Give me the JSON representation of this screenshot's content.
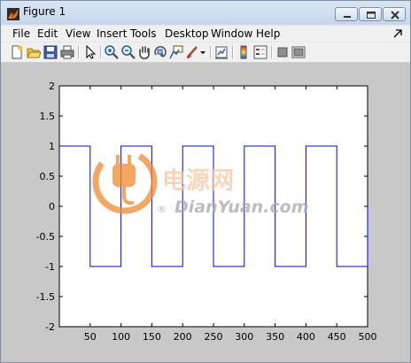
{
  "window": {
    "title": "Figure 1",
    "icons": {
      "app": "matlab-figure-icon",
      "minimize": "minimize-icon",
      "maximize": "maximize-icon",
      "close": "close-icon"
    }
  },
  "menubar": {
    "items": [
      "File",
      "Edit",
      "View",
      "Insert",
      "Tools",
      "Desktop",
      "Window",
      "Help"
    ],
    "dock_icon": "dock-arrow-icon"
  },
  "toolbar": {
    "icons": [
      "new-figure-icon",
      "open-file-icon",
      "save-icon",
      "print-icon",
      "pointer-icon",
      "zoom-in-icon",
      "zoom-out-icon",
      "pan-hand-icon",
      "rotate-3d-icon",
      "data-cursor-icon",
      "brush-icon",
      "dropdown-arrow-icon",
      "link-plot-icon",
      "colorbar-icon",
      "legend-icon",
      "hide-plot-tools-icon",
      "show-plot-tools-icon"
    ]
  },
  "watermark": {
    "chinese_text": "电源网",
    "site_text": "DianYuan.com",
    "registered_mark": "®",
    "logo_icon": "power-plug-logo-icon"
  },
  "chart_data": {
    "type": "line",
    "xlim": [
      0,
      500
    ],
    "ylim": [
      -2,
      2
    ],
    "x_ticks": [
      "50",
      "100",
      "150",
      "200",
      "250",
      "300",
      "350",
      "400",
      "450",
      "500"
    ],
    "y_ticks": [
      "2",
      "1.5",
      "1",
      "0.5",
      "0",
      "-0.5",
      "-1",
      "-1.5",
      "-2"
    ],
    "grid": false,
    "series": [
      {
        "color": "#0000ff",
        "x": [
          0,
          50,
          50,
          100,
          100,
          150,
          150,
          200,
          200,
          250,
          250,
          300,
          300,
          350,
          350,
          400,
          400,
          450,
          450,
          500,
          500
        ],
        "y": [
          1,
          1,
          -1,
          -1,
          1,
          1,
          -1,
          -1,
          1,
          1,
          -1,
          -1,
          1,
          1,
          -1,
          -1,
          1,
          1,
          -1,
          -1,
          0
        ]
      }
    ]
  }
}
